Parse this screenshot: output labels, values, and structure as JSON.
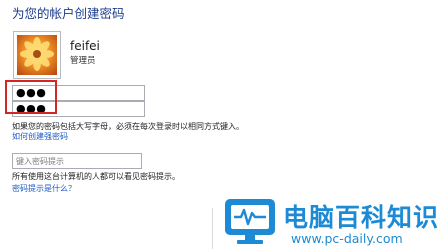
{
  "header": {
    "title": "为您的帐户创建密码"
  },
  "user": {
    "name": "feifei",
    "role": "管理员"
  },
  "form": {
    "password_value": "●●●",
    "confirm_value": "●●●",
    "case_hint": "如果您的密码包括大写字母，必须在每次登录时以相同方式键入。",
    "strong_password_link": "如何创建强密码",
    "hint_placeholder": "键入密码提示",
    "hint_note": "所有使用这台计算机的人都可以看见密码提示。",
    "hint_help_link": "密码提示是什么？"
  },
  "watermark": {
    "name": "电脑百科知识",
    "url": "www.pc-daily.com"
  },
  "colors": {
    "title": "#1c3d8c",
    "link": "#1c59c9",
    "highlight": "#d42626",
    "watermark": "#1c8ad4"
  },
  "icons": [
    "user-avatar-flower",
    "pc-daily-logo"
  ]
}
